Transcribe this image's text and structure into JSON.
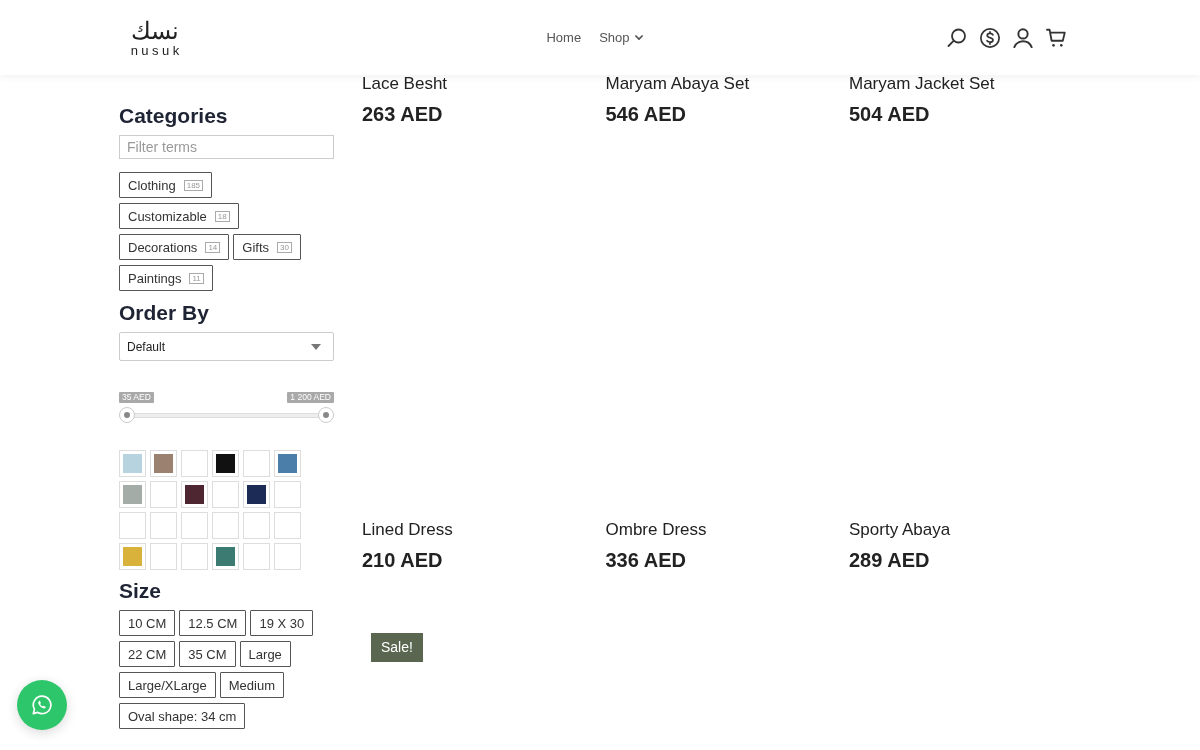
{
  "header": {
    "logo": {
      "arabic": "نسك",
      "latin": "nusuk"
    },
    "nav": [
      {
        "label": "Home",
        "has_menu": false
      },
      {
        "label": "Shop",
        "has_menu": true
      }
    ]
  },
  "sidebar": {
    "categories": {
      "title": "Categories",
      "filter": {
        "placeholder": "Filter terms"
      },
      "items": [
        {
          "label": "Clothing",
          "count": "185"
        },
        {
          "label": "Customizable",
          "count": "18"
        },
        {
          "label": "Decorations",
          "count": "14"
        },
        {
          "label": "Gifts",
          "count": "30"
        },
        {
          "label": "Paintings",
          "count": "11"
        }
      ]
    },
    "order_by": {
      "title": "Order By",
      "value": "Default"
    },
    "price": {
      "min_label": "35 AED",
      "max_label": "1 200 AED",
      "thumbs": [
        {
          "level": 0
        },
        {
          "level": 1
        }
      ]
    },
    "colors": [
      {
        "color": "#b7d3df"
      },
      {
        "color": "#9b8170"
      },
      {
        "color": "#ffffff"
      },
      {
        "color": "#111111"
      },
      {
        "color": "#ffffff"
      },
      {
        "color": "#4b7ea9"
      },
      {
        "color": "#a3aca6"
      },
      {
        "color": "#ffffff"
      },
      {
        "color": "#4d2631"
      },
      {
        "color": "#ffffff"
      },
      {
        "color": "#1c2b55"
      },
      {
        "color": "#ffffff"
      },
      {
        "color": "#ffffff"
      },
      {
        "color": "#ffffff"
      },
      {
        "color": "#ffffff"
      },
      {
        "color": "#ffffff"
      },
      {
        "color": "#ffffff"
      },
      {
        "color": "#ffffff"
      },
      {
        "color": "#d8b23a"
      },
      {
        "color": "#ffffff"
      },
      {
        "color": "#ffffff"
      },
      {
        "color": "#3b7b72"
      },
      {
        "color": "#ffffff"
      },
      {
        "color": "#ffffff"
      }
    ],
    "size": {
      "title": "Size",
      "items": [
        "10 CM",
        "12.5 CM",
        "19 X 30",
        "22 CM",
        "35 CM",
        "Large",
        "Large/XLarge",
        "Medium",
        "Oval shape: 34 cm"
      ]
    }
  },
  "products": [
    {
      "name": "Lace Besht",
      "price": "263 AED"
    },
    {
      "name": "Maryam Abaya Set",
      "price": "546 AED"
    },
    {
      "name": "Maryam Jacket Set",
      "price": "504 AED"
    },
    {
      "name": "Lined Dress",
      "price": "210 AED"
    },
    {
      "name": "Ombre Dress",
      "price": "336 AED"
    },
    {
      "name": "Sporty Abaya",
      "price": "289 AED"
    },
    {
      "badge": "Sale!"
    }
  ]
}
